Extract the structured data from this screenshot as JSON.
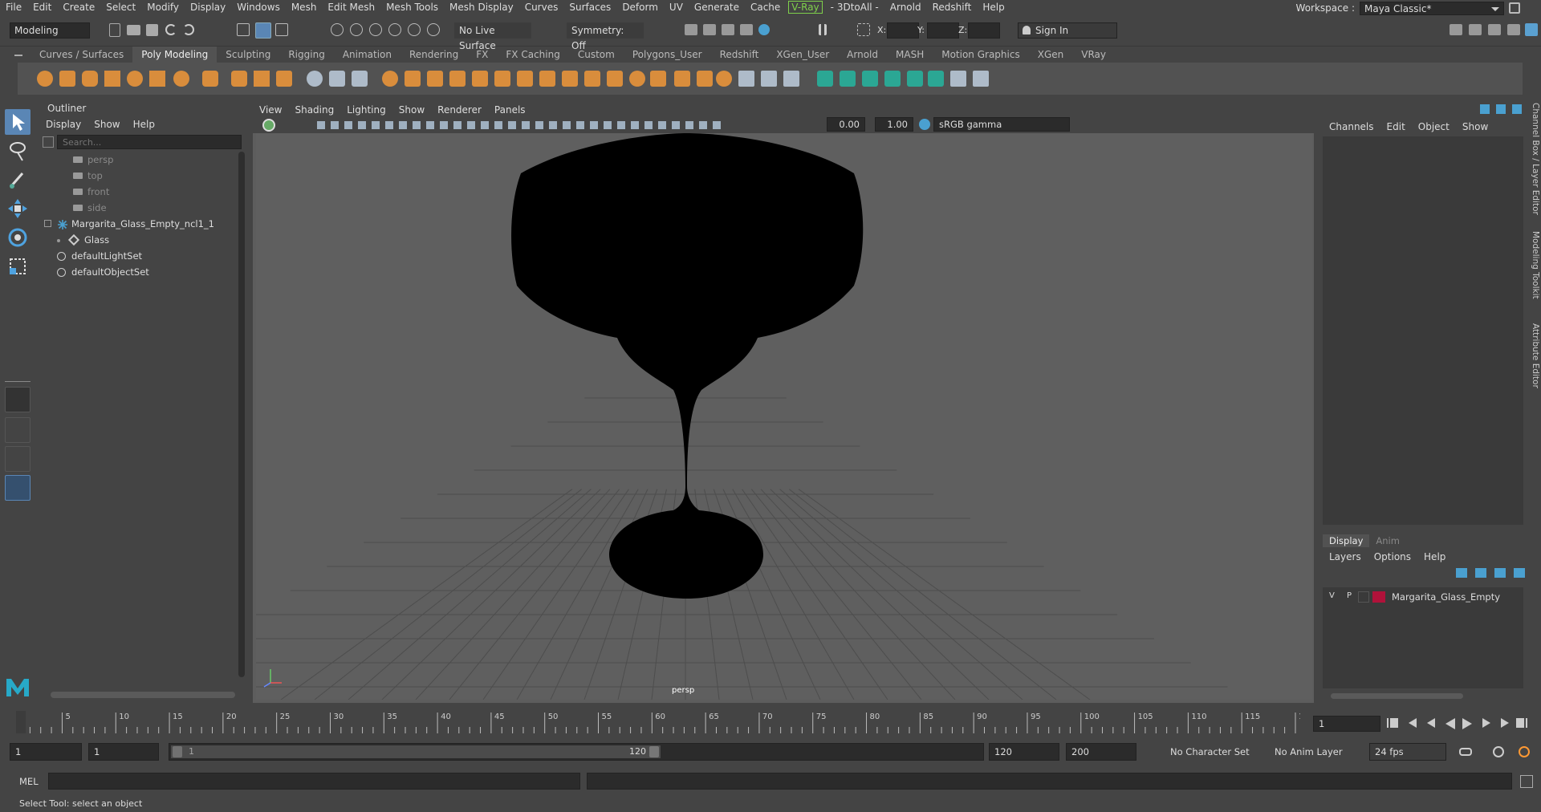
{
  "menubar": {
    "items": [
      "File",
      "Edit",
      "Create",
      "Select",
      "Modify",
      "Display",
      "Windows",
      "Mesh",
      "Edit Mesh",
      "Mesh Tools",
      "Mesh Display",
      "Curves",
      "Surfaces",
      "Deform",
      "UV",
      "Generate",
      "Cache",
      "V-Ray",
      "- 3DtoAll -",
      "Arnold",
      "Redshift",
      "Help"
    ]
  },
  "workspace": {
    "label": "Workspace :",
    "value": "Maya Classic*"
  },
  "statusline": {
    "mode": "Modeling",
    "live_surface": "No Live Surface",
    "symmetry": "Symmetry: Off",
    "x_label": "X:",
    "y_label": "Y:",
    "z_label": "Z:",
    "sign_in": "Sign In"
  },
  "shelf_tabs": [
    "Curves / Surfaces",
    "Poly Modeling",
    "Sculpting",
    "Rigging",
    "Animation",
    "Rendering",
    "FX",
    "FX Caching",
    "Custom",
    "Polygons_User",
    "Redshift",
    "XGen_User",
    "Arnold",
    "MASH",
    "Motion Graphics",
    "XGen",
    "VRay"
  ],
  "shelf_active": "Poly Modeling",
  "outliner": {
    "title": "Outliner",
    "menu": [
      "Display",
      "Show",
      "Help"
    ],
    "search_placeholder": "Search...",
    "items": [
      {
        "label": "persp",
        "type": "camera",
        "dim": true,
        "indent": 1
      },
      {
        "label": "top",
        "type": "camera",
        "dim": true,
        "indent": 1
      },
      {
        "label": "front",
        "type": "camera",
        "dim": true,
        "indent": 1
      },
      {
        "label": "side",
        "type": "camera",
        "dim": true,
        "indent": 1
      },
      {
        "label": "Margarita_Glass_Empty_ncl1_1",
        "type": "group",
        "dim": false,
        "indent": 0
      },
      {
        "label": "Glass",
        "type": "mesh",
        "dim": false,
        "indent": 1
      },
      {
        "label": "defaultLightSet",
        "type": "set",
        "dim": false,
        "indent": 0
      },
      {
        "label": "defaultObjectSet",
        "type": "set",
        "dim": false,
        "indent": 0
      }
    ]
  },
  "viewport": {
    "menu": [
      "View",
      "Shading",
      "Lighting",
      "Show",
      "Renderer",
      "Panels"
    ],
    "near": "0.00",
    "far": "1.00",
    "color_space": "sRGB gamma",
    "camera_label": "persp"
  },
  "channel_box": {
    "menu": [
      "Channels",
      "Edit",
      "Object",
      "Show"
    ],
    "side_tabs": [
      "Channel Box / Layer Editor",
      "Modeling Toolkit",
      "Attribute Editor"
    ]
  },
  "layer_editor": {
    "tabs": [
      "Display",
      "Anim"
    ],
    "menu": [
      "Layers",
      "Options",
      "Help"
    ],
    "layer": {
      "v": "V",
      "p": "P",
      "name": "Margarita_Glass_Empty",
      "color": "#b0123a"
    }
  },
  "timeline": {
    "ticks": [
      "5",
      "10",
      "15",
      "20",
      "25",
      "30",
      "35",
      "40",
      "45",
      "50",
      "55",
      "60",
      "65",
      "70",
      "75",
      "80",
      "85",
      "90",
      "95",
      "100",
      "105",
      "110",
      "115",
      "120"
    ],
    "start_tick": "1",
    "current_frame": "1"
  },
  "range": {
    "start": "1",
    "playback_start": "1",
    "slider_start": "1",
    "slider_end": "120",
    "playback_end": "120",
    "end": "200",
    "char_set": "No Character Set",
    "anim_layer": "No Anim Layer",
    "fps": "24 fps"
  },
  "cmd": {
    "label": "MEL"
  },
  "help": {
    "text": "Select Tool: select an object"
  }
}
